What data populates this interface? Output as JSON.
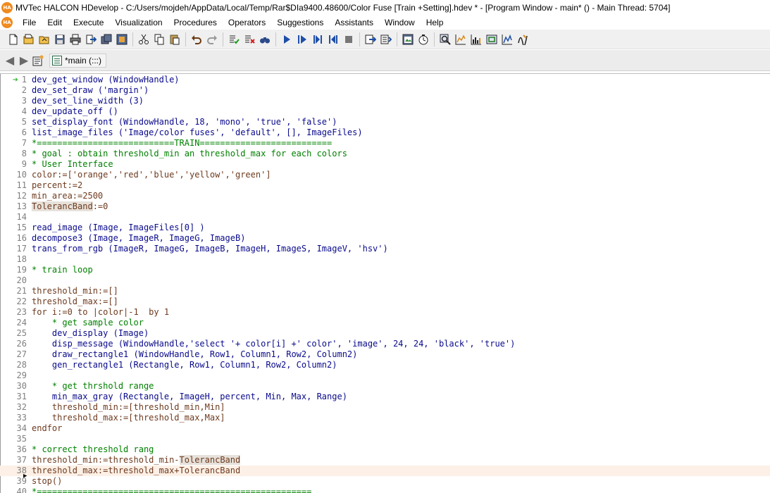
{
  "titlebar": {
    "logo": "HA",
    "title": "MVTec HALCON HDevelop - C:/Users/mojdeh/AppData/Local/Temp/Rar$DIa9400.48600/Color Fuse [Train +Setting].hdev * - [Program Window - main* () - Main Thread: 5704]"
  },
  "menubar": {
    "logo": "HA",
    "items": [
      "File",
      "Edit",
      "Execute",
      "Visualization",
      "Procedures",
      "Operators",
      "Suggestions",
      "Assistants",
      "Window",
      "Help"
    ]
  },
  "toolbar": {
    "buttons": [
      "new-file-icon",
      "open-file-icon",
      "open-folder-icon",
      "save-icon",
      "print-icon",
      "export-icon",
      "save-all-icon",
      "insert-icon",
      "cut-icon",
      "copy-icon",
      "paste-icon",
      "undo-icon",
      "redo-icon",
      "activate-icon",
      "deactivate-icon",
      "binoculars-icon",
      "run-icon",
      "step-over-icon",
      "step-forward-icon",
      "step-back-icon",
      "stop-icon",
      "reset-program-icon",
      "reset-procedure-icon",
      "image-window-icon",
      "timer-icon",
      "zoom-icon",
      "histogram-icon",
      "line-profile-icon",
      "region-info-icon",
      "feature-histogram-icon",
      "feature-inspection-icon"
    ]
  },
  "navbar": {
    "back_icon": "back-arrow-icon",
    "forward_icon": "forward-arrow-icon",
    "procedure_label": "*main (:::)"
  },
  "editor": {
    "current_line": 38,
    "program_counter_line": 1,
    "lines": [
      {
        "n": "1",
        "parts": [
          {
            "t": "dev_get_window (WindowHandle)",
            "c": "op"
          }
        ]
      },
      {
        "n": "2",
        "parts": [
          {
            "t": "dev_set_draw ('margin')",
            "c": "op"
          }
        ]
      },
      {
        "n": "3",
        "parts": [
          {
            "t": "dev_set_line_width (3)",
            "c": "op"
          }
        ]
      },
      {
        "n": "4",
        "parts": [
          {
            "t": "dev_update_off ()",
            "c": "op"
          }
        ]
      },
      {
        "n": "5",
        "parts": [
          {
            "t": "set_display_font (WindowHandle, 18, 'mono', 'true', 'false')",
            "c": "op"
          }
        ]
      },
      {
        "n": "6",
        "parts": [
          {
            "t": "list_image_files ('Image/color fuses', 'default', [], ImageFiles)",
            "c": "op"
          }
        ]
      },
      {
        "n": "7",
        "parts": [
          {
            "t": "*===========================TRAIN==========================",
            "c": "cm"
          }
        ]
      },
      {
        "n": "8",
        "parts": [
          {
            "t": "* goal : obtain threshold_min an threshold_max for each colors",
            "c": "cm"
          }
        ]
      },
      {
        "n": "9",
        "parts": [
          {
            "t": "* User Interface",
            "c": "cm"
          }
        ]
      },
      {
        "n": "10",
        "parts": [
          {
            "t": "color:=['orange','red','blue','yellow','green']",
            "c": "as"
          }
        ]
      },
      {
        "n": "11",
        "parts": [
          {
            "t": "percent:=2",
            "c": "as"
          }
        ]
      },
      {
        "n": "12",
        "parts": [
          {
            "t": "min_area:=2500",
            "c": "as"
          }
        ]
      },
      {
        "n": "13",
        "parts": [
          {
            "t": "TolerancBand",
            "c": "as",
            "hl": true
          },
          {
            "t": ":=0",
            "c": "as"
          }
        ]
      },
      {
        "n": "14",
        "parts": []
      },
      {
        "n": "15",
        "parts": [
          {
            "t": "read_image (Image, ImageFiles[0] )",
            "c": "op"
          }
        ]
      },
      {
        "n": "16",
        "parts": [
          {
            "t": "decompose3 (Image, ImageR, ImageG, ImageB)",
            "c": "op"
          }
        ]
      },
      {
        "n": "17",
        "parts": [
          {
            "t": "trans_from_rgb (ImageR, ImageG, ImageB, ImageH, ImageS, ImageV, 'hsv')",
            "c": "op"
          }
        ]
      },
      {
        "n": "18",
        "parts": []
      },
      {
        "n": "19",
        "parts": [
          {
            "t": "* train loop",
            "c": "cm"
          }
        ]
      },
      {
        "n": "20",
        "parts": []
      },
      {
        "n": "21",
        "parts": [
          {
            "t": "threshold_min:=[]",
            "c": "as"
          }
        ]
      },
      {
        "n": "22",
        "parts": [
          {
            "t": "threshold_max:=[]",
            "c": "as"
          }
        ]
      },
      {
        "n": "23",
        "parts": [
          {
            "t": "for i:=0 to |color|-1  by 1",
            "c": "as"
          }
        ]
      },
      {
        "n": "24",
        "parts": [
          {
            "t": "    * get sample color",
            "c": "cm"
          }
        ]
      },
      {
        "n": "25",
        "parts": [
          {
            "t": "    dev_display (Image)",
            "c": "op"
          }
        ]
      },
      {
        "n": "26",
        "parts": [
          {
            "t": "    disp_message (WindowHandle,'select '+ color[i] +' color', 'image', 24, 24, 'black', 'true')",
            "c": "op"
          }
        ]
      },
      {
        "n": "27",
        "parts": [
          {
            "t": "    draw_rectangle1 (WindowHandle, Row1, Column1, Row2, Column2)",
            "c": "op"
          }
        ]
      },
      {
        "n": "28",
        "parts": [
          {
            "t": "    gen_rectangle1 (Rectangle, Row1, Column1, Row2, Column2)",
            "c": "op"
          }
        ]
      },
      {
        "n": "29",
        "parts": []
      },
      {
        "n": "30",
        "parts": [
          {
            "t": "    * get thrshold range",
            "c": "cm"
          }
        ]
      },
      {
        "n": "31",
        "parts": [
          {
            "t": "    min_max_gray (Rectangle, ImageH, percent, Min, Max, Range)",
            "c": "op"
          }
        ]
      },
      {
        "n": "32",
        "parts": [
          {
            "t": "    threshold_min:=[threshold_min,Min]",
            "c": "as"
          }
        ]
      },
      {
        "n": "33",
        "parts": [
          {
            "t": "    threshold_max:=[threshold_max,Max]",
            "c": "as"
          }
        ]
      },
      {
        "n": "34",
        "parts": [
          {
            "t": "endfor",
            "c": "as"
          }
        ]
      },
      {
        "n": "35",
        "parts": []
      },
      {
        "n": "36",
        "parts": [
          {
            "t": "* correct threshold rang",
            "c": "cm"
          }
        ]
      },
      {
        "n": "37",
        "parts": [
          {
            "t": "threshold_min:=threshold_min-",
            "c": "as"
          },
          {
            "t": "TolerancBand",
            "c": "as",
            "hl": true
          }
        ]
      },
      {
        "n": "38",
        "parts": [
          {
            "t": "threshold_max:=threshold_max+TolerancBand",
            "c": "as"
          }
        ]
      },
      {
        "n": "39",
        "parts": [
          {
            "t": "stop()",
            "c": "as"
          }
        ]
      },
      {
        "n": "40",
        "parts": [
          {
            "t": "*======================================================",
            "c": "cm"
          }
        ]
      }
    ]
  },
  "colors": {
    "operator": "#0a0a8c",
    "comment": "#008000",
    "assignment": "#6e3a1e",
    "current_line_bg": "#fdf0e6",
    "pc_arrow": "#2fb12f",
    "logo": "#f08a1e"
  }
}
